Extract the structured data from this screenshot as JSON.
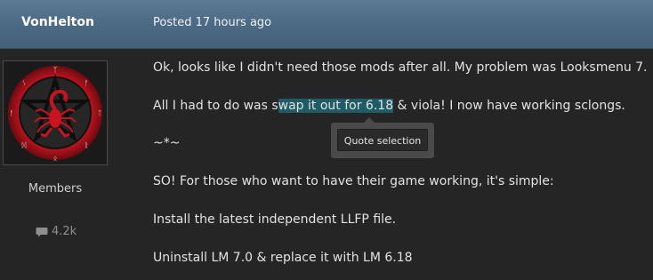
{
  "header": {
    "author": "VonHelton",
    "posted": "Posted 17 hours ago"
  },
  "profile": {
    "role": "Members",
    "reputation": "4.2k",
    "reputation_icon": "speech-bubble-icon"
  },
  "post": {
    "p1": "Ok, looks like I didn't need those mods after all. My problem was Looksmenu 7.",
    "p2_before": "All I had to do was s",
    "p2_highlight": "wap it out for 6.18",
    "p2_after": " & viola! I now have working sclongs.",
    "p3": "~*~",
    "p4": "SO! For those who want to have their game working, it's simple:",
    "p5": "Install the latest independent LLFP file.",
    "p6": "Uninstall LM 7.0 & replace it with LM 6.18"
  },
  "tooltip": {
    "quote_label": "Quote selection"
  },
  "colors": {
    "header": "#4d6a84",
    "background": "#252525",
    "selection": "#1f5c66",
    "avatar_ring": "#b3101c"
  }
}
